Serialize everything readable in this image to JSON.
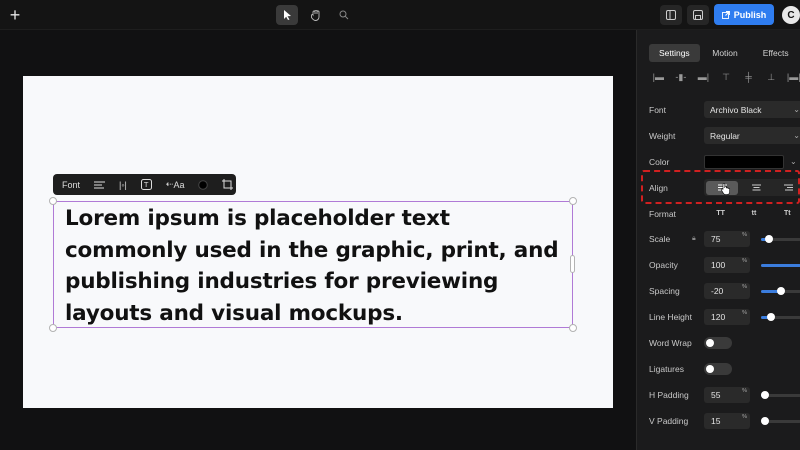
{
  "topbar": {
    "add_icon": "plus-icon",
    "tools": [
      "cursor-icon",
      "hand-icon",
      "search-icon"
    ],
    "publish_label": "Publish"
  },
  "canvas": {
    "floating_toolbar": {
      "font_label": "Font",
      "case_label": "Aa"
    },
    "text_content": "Lorem ipsum is placeholder text commonly used in the graphic, print, and publishing industries for previewing layouts and visual mockups."
  },
  "panel": {
    "tabs": [
      {
        "label": "Settings",
        "active": true
      },
      {
        "label": "Motion",
        "active": false
      },
      {
        "label": "Effects",
        "active": false
      }
    ],
    "font": {
      "label": "Font",
      "value": "Archivo Black"
    },
    "weight": {
      "label": "Weight",
      "value": "Regular"
    },
    "color": {
      "label": "Color",
      "value": "#000000"
    },
    "align": {
      "label": "Align",
      "selected": "left"
    },
    "format": {
      "label": "Format",
      "options": [
        "TT",
        "tt",
        "Tt"
      ]
    },
    "scale": {
      "label": "Scale",
      "value": "75",
      "unit": "%",
      "level": 0.2
    },
    "opacity": {
      "label": "Opacity",
      "value": "100",
      "unit": "%",
      "level": 1.0
    },
    "spacing": {
      "label": "Spacing",
      "value": "-20",
      "unit": "%",
      "level": 0.5
    },
    "line_height": {
      "label": "Line Height",
      "value": "120",
      "unit": "%",
      "level": 0.25
    },
    "word_wrap": {
      "label": "Word Wrap",
      "on": false
    },
    "ligatures": {
      "label": "Ligatures",
      "on": false
    },
    "h_padding": {
      "label": "H Padding",
      "value": "55",
      "unit": "%",
      "level": 0.1
    },
    "v_padding": {
      "label": "V Padding",
      "value": "15",
      "unit": "%",
      "level": 0.0
    }
  },
  "colors": {
    "accent": "#2f7df0",
    "highlight": "#d02020",
    "selection": "#b07ad6"
  }
}
